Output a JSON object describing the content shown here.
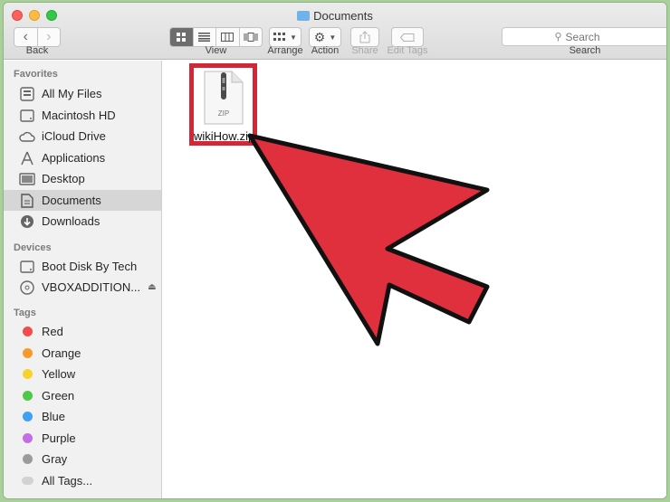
{
  "window": {
    "title": "Documents"
  },
  "toolbar": {
    "back_label": "Back",
    "view_label": "View",
    "arrange_label": "Arrange",
    "action_label": "Action",
    "share_label": "Share",
    "edit_tags_label": "Edit Tags",
    "search_label": "Search",
    "search_placeholder": "Search"
  },
  "sidebar": {
    "favorites_header": "Favorites",
    "favorites": [
      {
        "label": "All My Files",
        "icon": "all-files-icon"
      },
      {
        "label": "Macintosh HD",
        "icon": "hard-drive-icon"
      },
      {
        "label": "iCloud Drive",
        "icon": "cloud-icon"
      },
      {
        "label": "Applications",
        "icon": "applications-icon"
      },
      {
        "label": "Desktop",
        "icon": "desktop-icon"
      },
      {
        "label": "Documents",
        "icon": "documents-icon",
        "selected": true
      },
      {
        "label": "Downloads",
        "icon": "downloads-icon"
      }
    ],
    "devices_header": "Devices",
    "devices": [
      {
        "label": "Boot Disk By Tech",
        "icon": "disk-icon"
      },
      {
        "label": "VBOXADDITION...",
        "icon": "optical-disc-icon",
        "ejectable": true
      }
    ],
    "tags_header": "Tags",
    "tags": [
      {
        "label": "Red",
        "color": "#f44c4c"
      },
      {
        "label": "Orange",
        "color": "#f79a2d"
      },
      {
        "label": "Yellow",
        "color": "#f8d22c"
      },
      {
        "label": "Green",
        "color": "#4fc84a"
      },
      {
        "label": "Blue",
        "color": "#3fa0f4"
      },
      {
        "label": "Purple",
        "color": "#c36ee6"
      },
      {
        "label": "Gray",
        "color": "#9b9b9b"
      },
      {
        "label": "All Tags...",
        "color": "#d2d2d2"
      }
    ]
  },
  "content": {
    "files": [
      {
        "name": "wikiHow.zip",
        "badge": "ZIP",
        "icon": "zip-file-icon"
      }
    ],
    "highlight_color": "#d32636",
    "arrow_color": "#e02f3d"
  }
}
